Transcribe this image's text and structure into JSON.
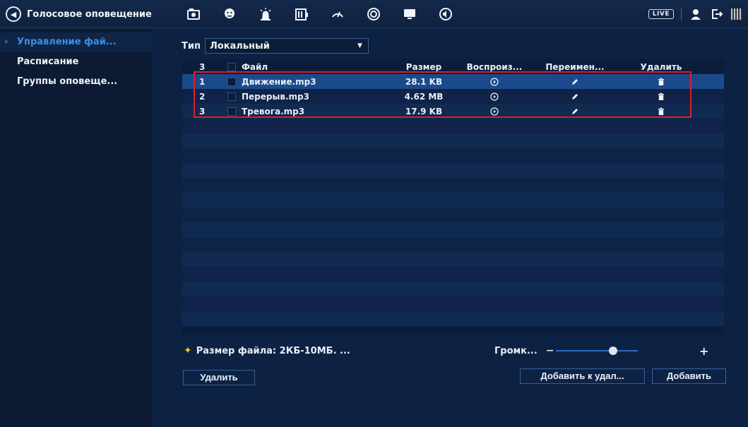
{
  "header": {
    "title": "Голосовое оповещение",
    "live_label": "LIVE",
    "menu_icons": [
      "camera-icon",
      "face-icon",
      "alarm-icon",
      "storage-icon",
      "dashboard-icon",
      "record-icon",
      "display-icon",
      "audio-icon"
    ]
  },
  "sidebar": {
    "items": [
      {
        "label": "Управление фай...",
        "active": true
      },
      {
        "label": "Расписание",
        "active": false
      },
      {
        "label": "Группы оповеще...",
        "active": false
      }
    ]
  },
  "filter": {
    "type_label": "Тип",
    "type_value": "Локальный"
  },
  "table": {
    "headers": {
      "num": "3",
      "file": "Файл",
      "size": "Размер",
      "play": "Воспроиз...",
      "rename": "Переимен...",
      "delete": "Удалить"
    },
    "rows": [
      {
        "num": "1",
        "file": "Движение.mp3",
        "size": "28.1 KB"
      },
      {
        "num": "2",
        "file": "Перерыв.mp3",
        "size": "4.62 MB"
      },
      {
        "num": "3",
        "file": "Тревога.mp3",
        "size": "17.9 KB"
      }
    ]
  },
  "footer": {
    "hint": "Размер файла: 2КБ-10МБ. ...",
    "volume_label": "Громк...",
    "volume_level": 0.72,
    "delete_button": "Удалить",
    "add_remote_button": "Добавить к удал...",
    "add_button": "Добавить"
  },
  "colors": {
    "accent": "#3a8fe8",
    "highlight_border": "#e01c2a",
    "selected_row": "#1b4a8c"
  }
}
